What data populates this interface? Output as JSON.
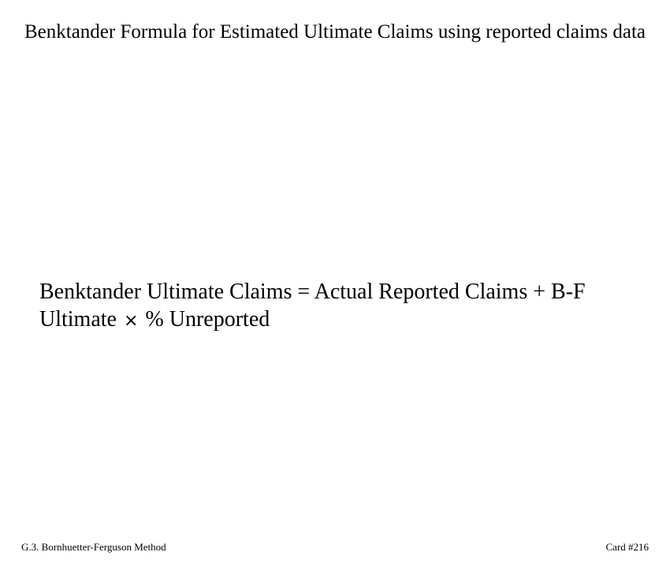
{
  "card": {
    "title": "Benktander Formula for Estimated Ultimate Claims using reported claims data",
    "formula": {
      "part1": "Benktander Ultimate Claims = Actual Reported Claims + B-F Ultimate",
      "operator": "×",
      "part2": "% Unreported"
    },
    "footer": {
      "section": "G.3. Bornhuetter-Ferguson Method",
      "card_number": "Card #216"
    }
  }
}
